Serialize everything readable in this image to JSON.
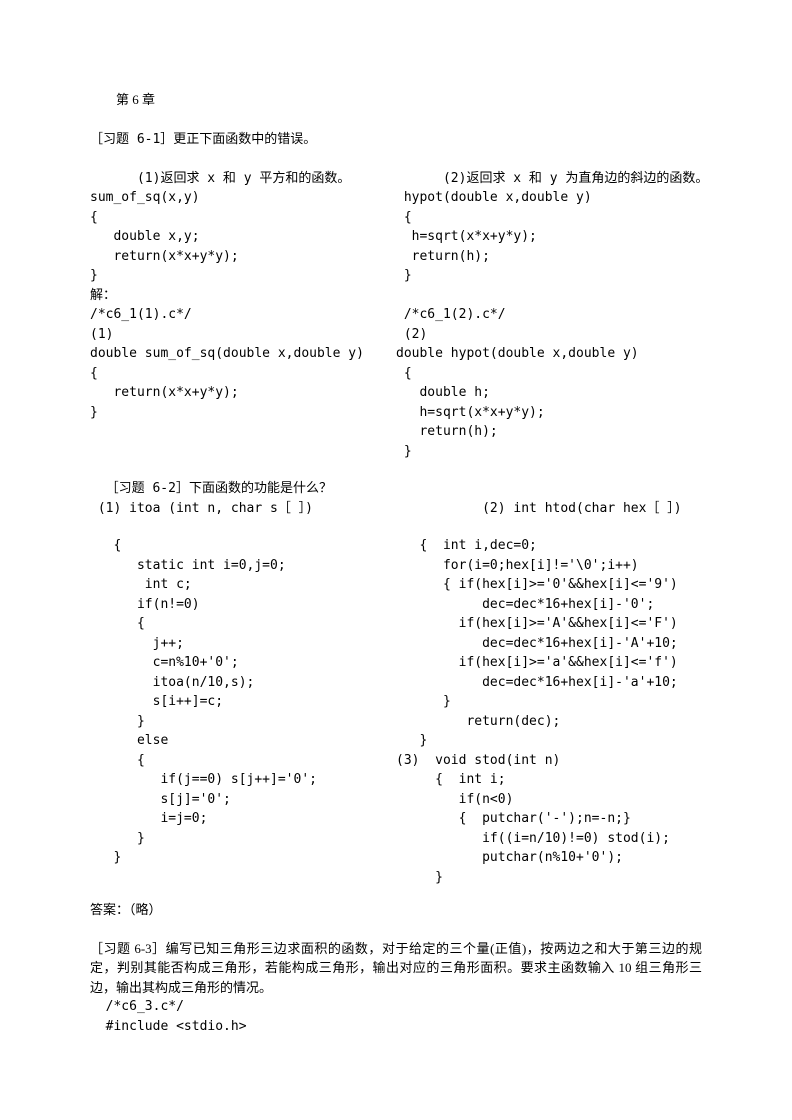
{
  "chapter": "第 6 章",
  "q61_title": "［习题 6-1］更正下面函数中的错误。",
  "q61_left_desc": "(1)返回求 x 和 y 平方和的函数。",
  "q61_left_code": "sum_of_sq(x,y)\n{\n   double x,y;\n   return(x*x+y*y);\n}\n解：\n/*c6_1(1).c*/\n(1)\ndouble sum_of_sq(double x,double y)\n{\n   return(x*x+y*y);\n}",
  "q61_right_desc": "(2)返回求 x 和 y 为直角边的斜边的函数。",
  "q61_right_code": " hypot(double x,double y)\n {\n  h=sqrt(x*x+y*y);\n  return(h);\n }\n\n /*c6_1(2).c*/\n (2)\ndouble hypot(double x,double y)\n {\n   double h;\n   h=sqrt(x*x+y*y);\n   return(h);\n }",
  "q62_title": "  ［习题 6-2］下面函数的功能是什么？",
  "q62_h_left": " (1) itoa (int n, char s［ ］)",
  "q62_h_right": "           (2) int htod(char hex［ ］)",
  "q62_left_code": "   {\n      static int i=0,j=0;\n       int c;\n      if(n!=0)\n      {\n        j++;\n        c=n%10+'0';\n        itoa(n/10,s);\n        s[i++]=c;\n      }\n      else\n      {\n         if(j==0) s[j++]='0';\n         s[j]='0';\n         i=j=0;\n      }\n   }",
  "q62_right_code": "   {  int i,dec=0;\n      for(i=0;hex[i]!='\\0';i++)\n      { if(hex[i]>='0'&&hex[i]<='9')\n           dec=dec*16+hex[i]-'0';\n        if(hex[i]>='A'&&hex[i]<='F')\n           dec=dec*16+hex[i]-'A'+10;\n        if(hex[i]>='a'&&hex[i]<='f')\n           dec=dec*16+hex[i]-'a'+10;\n      }\n         return(dec);\n   }\n(3)  void stod(int n)\n     {  int i;\n        if(n<0)\n        {  putchar('-');n=-n;}\n           if((i=n/10)!=0) stod(i);\n           putchar(n%10+'0');\n     }",
  "q62_answer": "答案：（略）",
  "q63_para": "  ［习题 6-3］编写已知三角形三边求面积的函数，对于给定的三个量(正值)，按两边之和大于第三边的规定，判别其能否构成三角形，若能构成三角形，输出对应的三角形面积。要求主函数输入 10 组三角形三边，输出其构成三角形的情况。",
  "q63_code": "  /*c6_3.c*/\n  #include <stdio.h>"
}
